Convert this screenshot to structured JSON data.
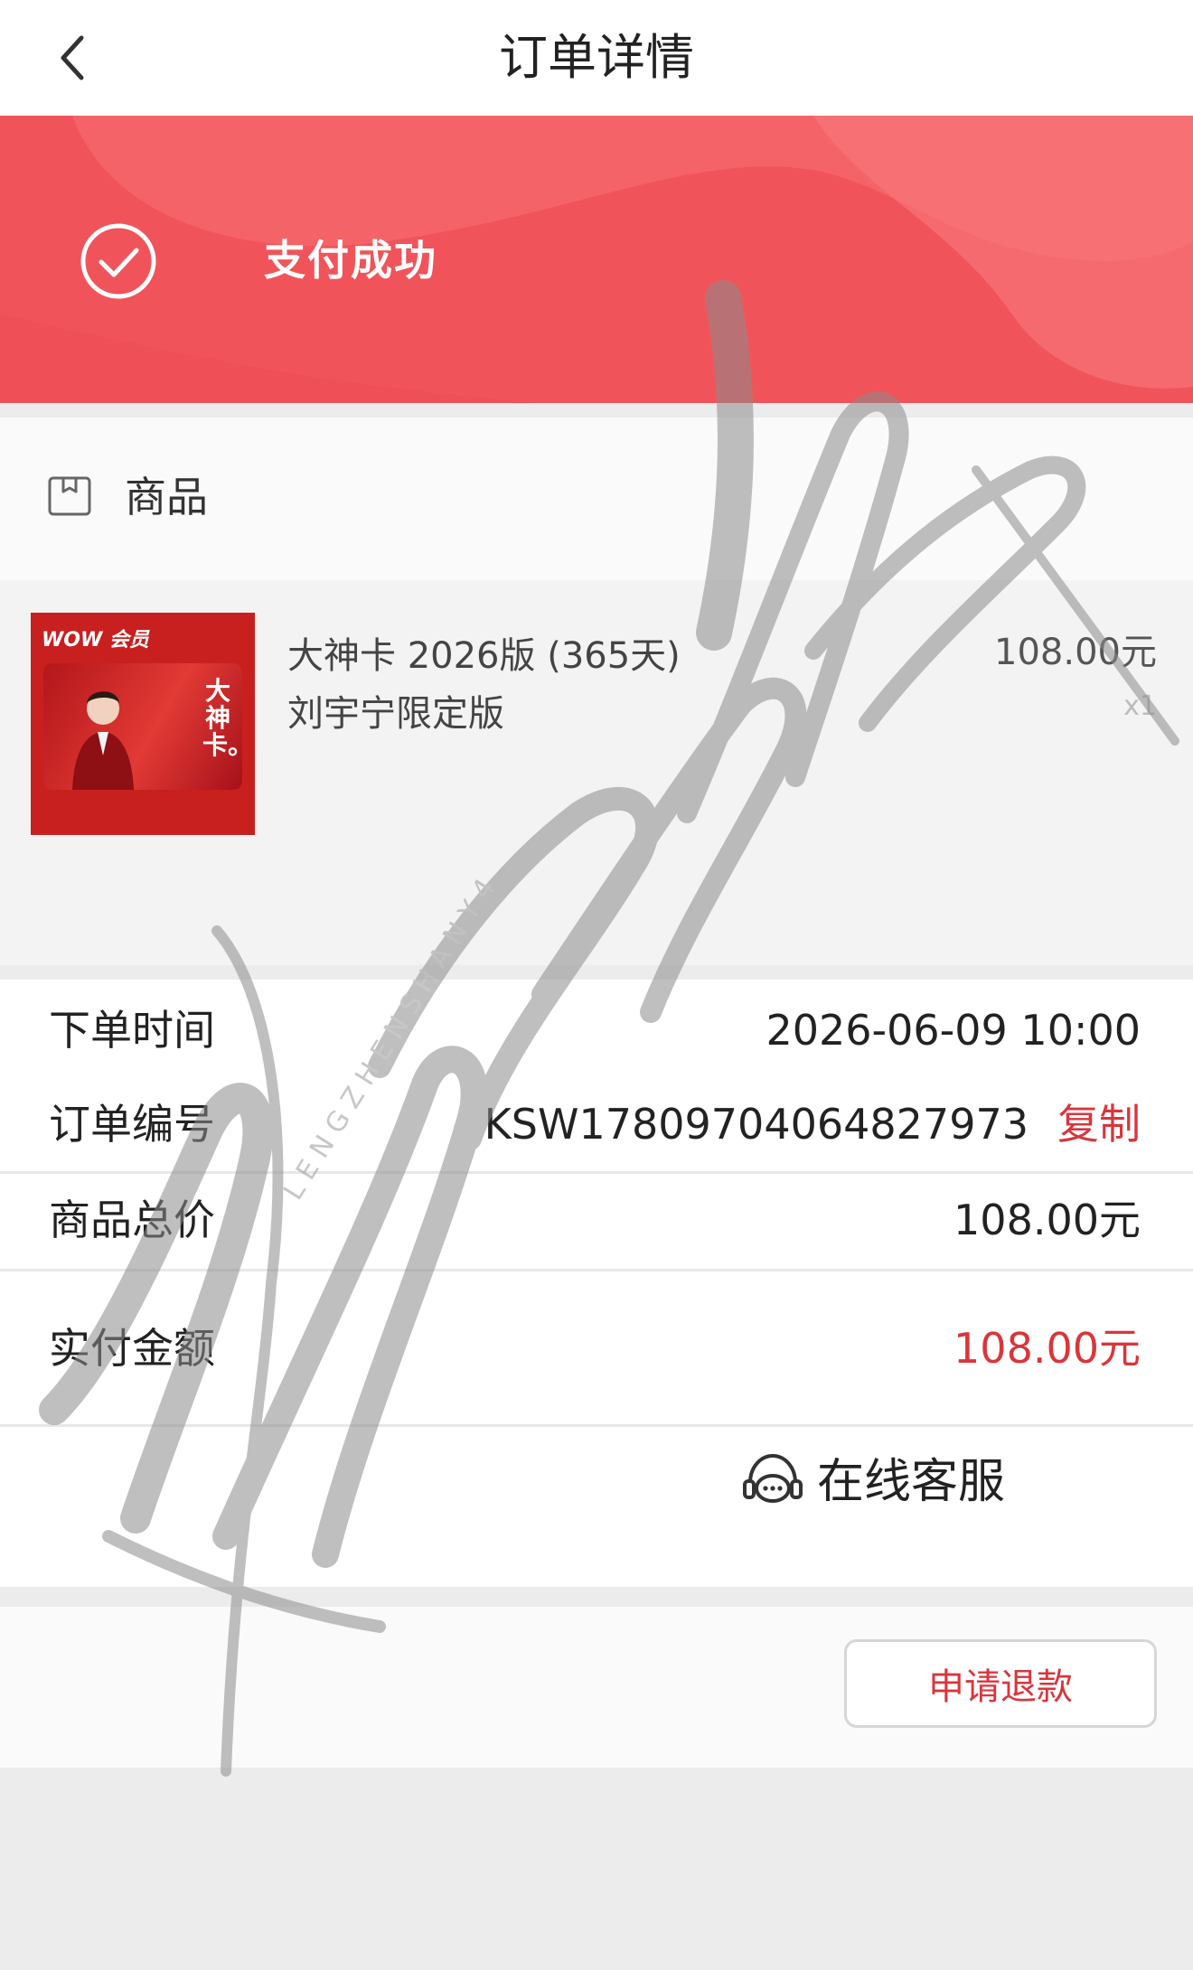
{
  "header": {
    "title": "订单详情",
    "back_icon": "chevron-left-icon"
  },
  "banner": {
    "status": "支付成功",
    "icon": "check-circle-icon",
    "color": "#f0545a"
  },
  "goods": {
    "section_label": "商品",
    "icon": "package-icon",
    "product": {
      "name": "大神卡 2026版 (365天) 刘宇宁限定版",
      "price": "108.00元",
      "qty": "x1",
      "thumb_title": "大神卡。",
      "thumb_logo": "WOW 会员"
    }
  },
  "info": {
    "order_time_label": "下单时间",
    "order_time": "2026-06-09 10:00",
    "order_no_label": "订单编号",
    "order_no": "KSW17809704064827973",
    "copy_label": "复制",
    "total_label": "商品总价",
    "total": "108.00元",
    "paid_label": "实付金额",
    "paid": "108.00元"
  },
  "service": {
    "label": "在线客服",
    "icon": "chat-support-icon"
  },
  "refund": {
    "label": "申请退款"
  },
  "watermark": {
    "text": "L E N G Z H E N S H A N Y 4"
  },
  "colors": {
    "accent": "#d8363c",
    "banner": "#f0545a"
  }
}
